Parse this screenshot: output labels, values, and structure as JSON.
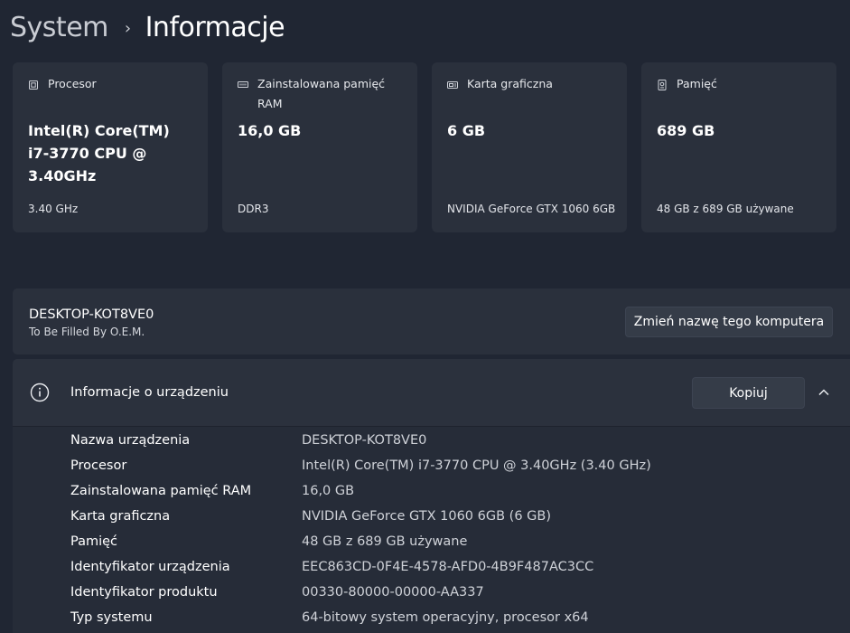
{
  "breadcrumb": {
    "parent": "System",
    "separator": "›",
    "current": "Informacje"
  },
  "cards": [
    {
      "icon": "processor-icon",
      "label": "Procesor",
      "value": "Intel(R) Core(TM) i7-3770 CPU @ 3.40GHz",
      "sub": "3.40 GHz"
    },
    {
      "icon": "memory-icon",
      "label": "Zainstalowana pamięć RAM",
      "value": "16,0 GB",
      "sub": "DDR3"
    },
    {
      "icon": "gpu-icon",
      "label": "Karta graficzna",
      "value": "6 GB",
      "sub": "NVIDIA GeForce GTX 1060 6GB"
    },
    {
      "icon": "storage-icon",
      "label": "Pamięć",
      "value": "689 GB",
      "sub": "48 GB z 689 GB używane"
    }
  ],
  "computer": {
    "name": "DESKTOP-KOT8VE0",
    "model": "To Be Filled By O.E.M.",
    "rename_label": "Zmień nazwę tego komputera"
  },
  "device_info": {
    "title": "Informacje o urządzeniu",
    "copy_label": "Kopiuj",
    "specs": [
      {
        "key": "Nazwa urządzenia",
        "value": "DESKTOP-KOT8VE0"
      },
      {
        "key": "Procesor",
        "value": "Intel(R) Core(TM) i7-3770 CPU @ 3.40GHz (3.40 GHz)"
      },
      {
        "key": "Zainstalowana pamięć RAM",
        "value": "16,0 GB"
      },
      {
        "key": "Karta graficzna",
        "value": "NVIDIA GeForce GTX 1060 6GB (6 GB)"
      },
      {
        "key": "Pamięć",
        "value": "48 GB z 689 GB używane"
      },
      {
        "key": "Identyfikator urządzenia",
        "value": "EEC863CD-0F4E-4578-AFD0-4B9F487AC3CC"
      },
      {
        "key": "Identyfikator produktu",
        "value": "00330-80000-00000-AA337"
      },
      {
        "key": "Typ systemu",
        "value": "64-bitowy system operacyjny, procesor x64"
      }
    ]
  }
}
